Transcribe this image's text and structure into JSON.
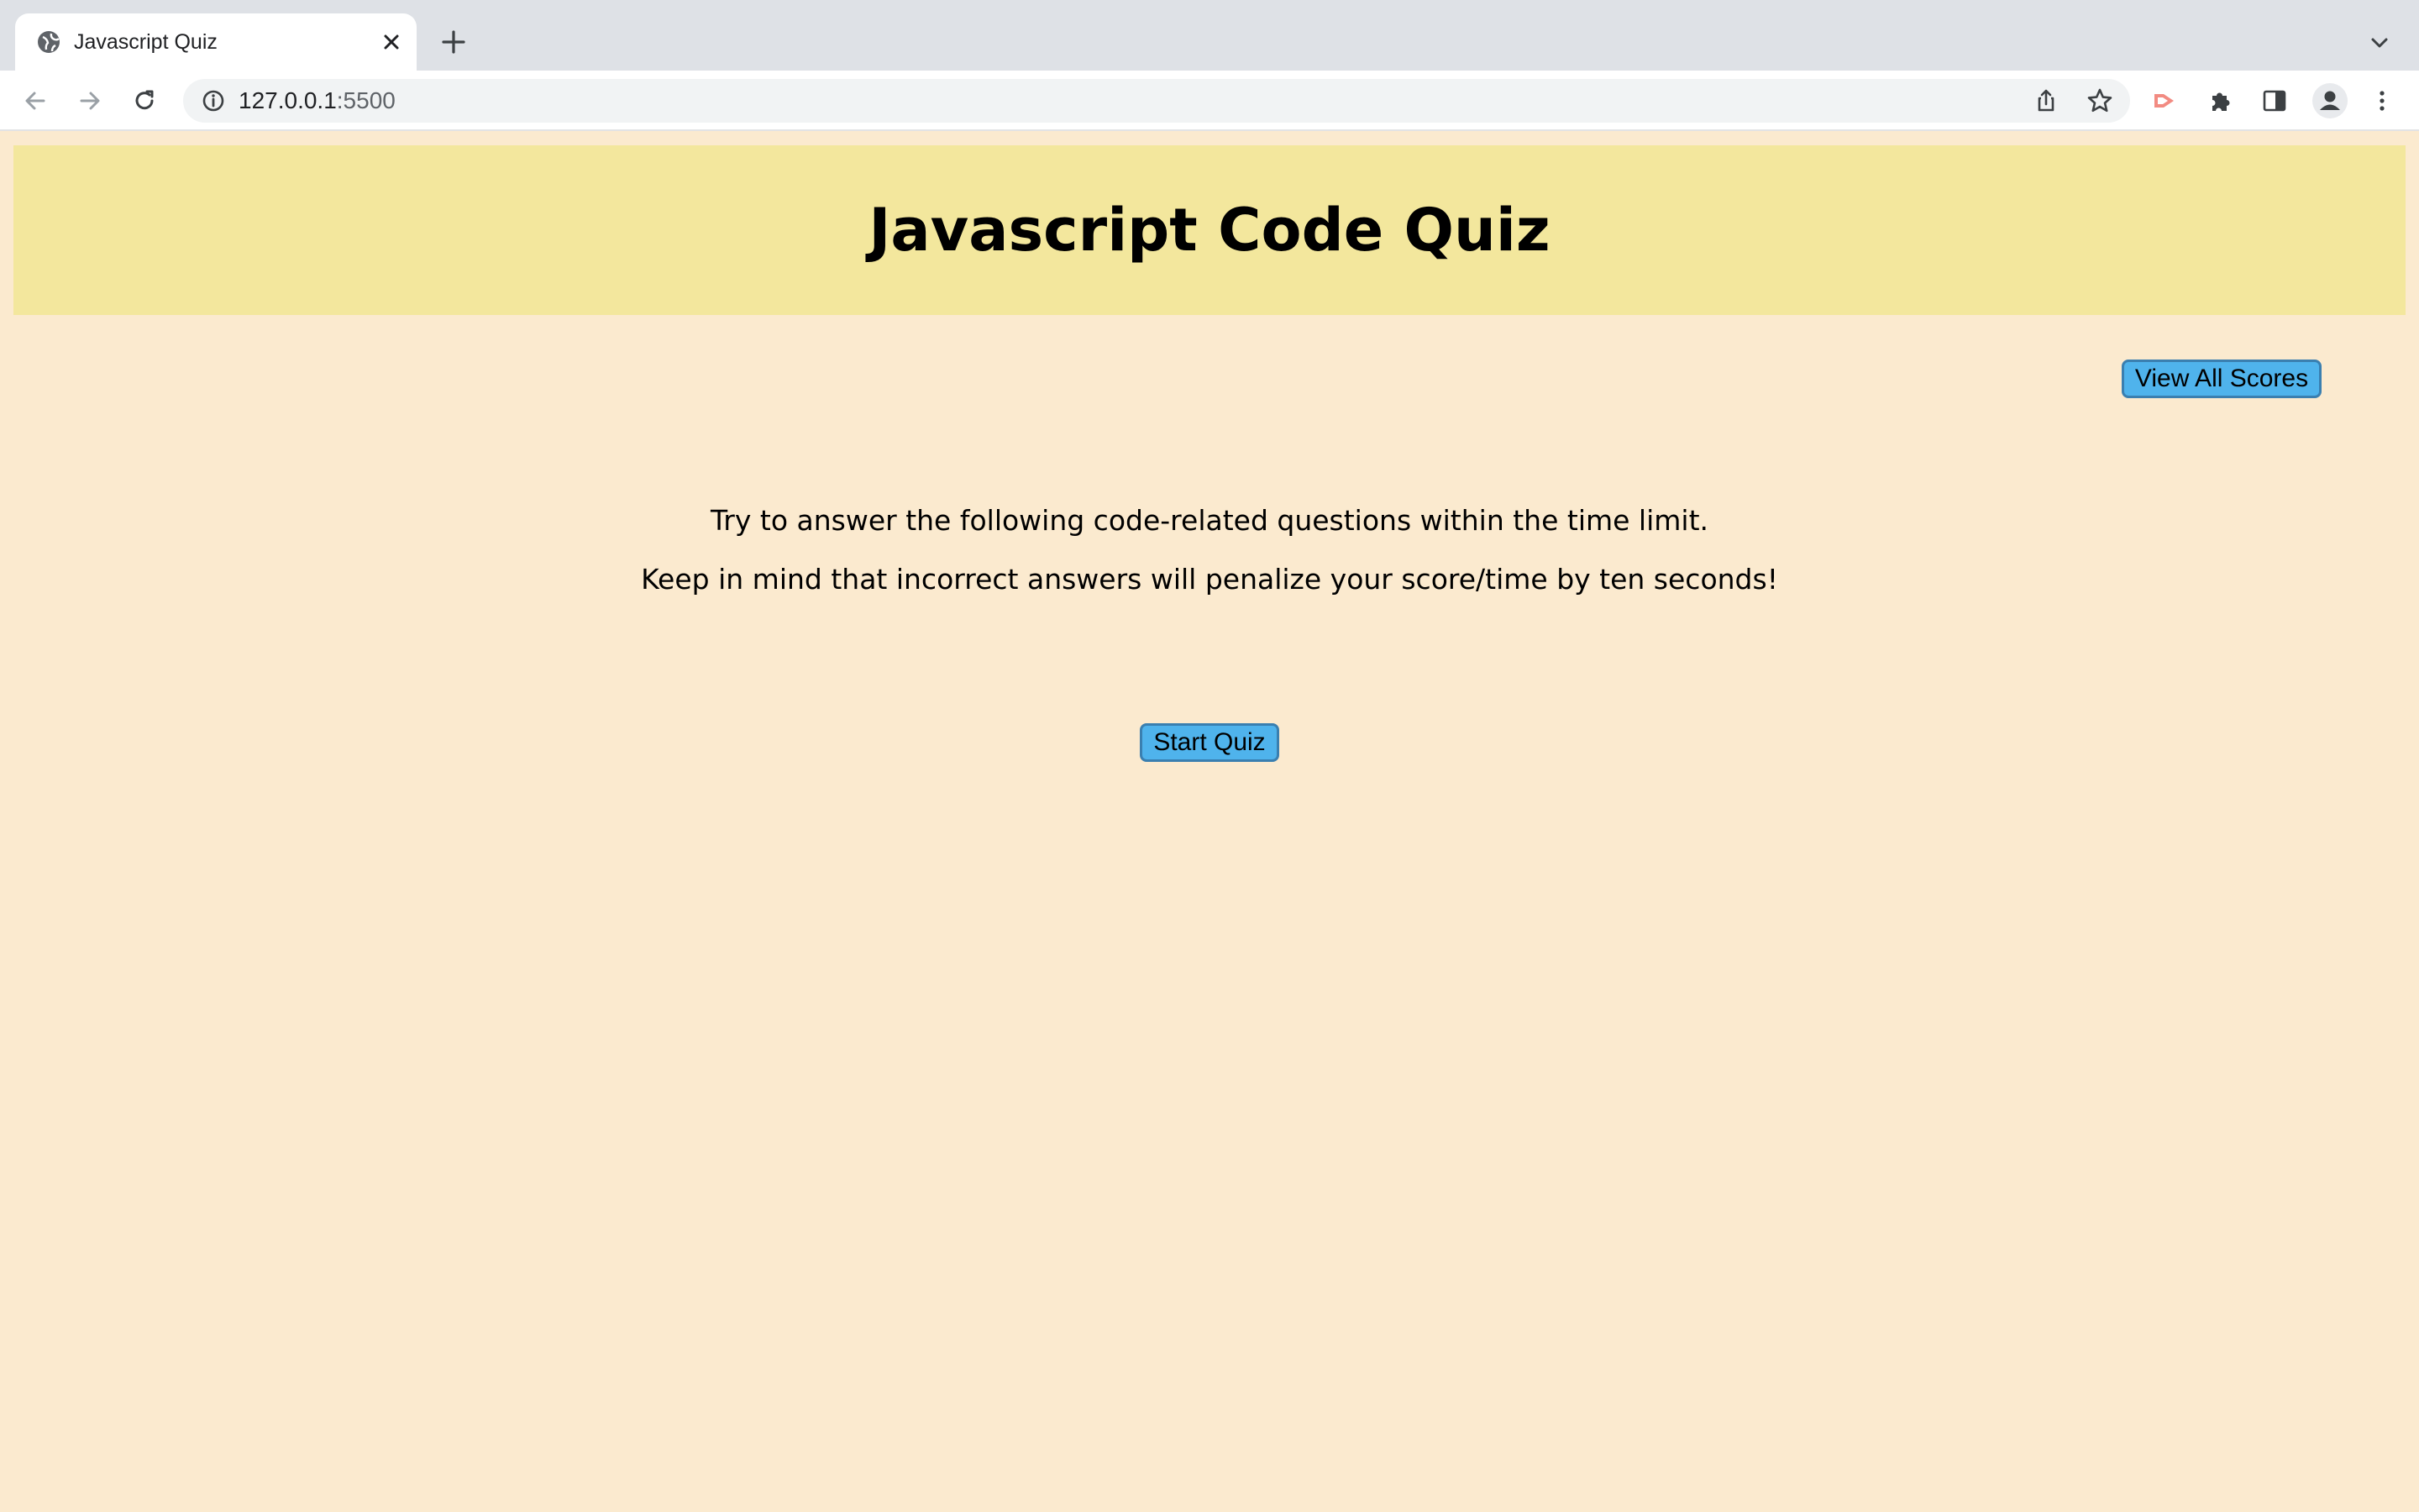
{
  "browser": {
    "tab_title": "Javascript Quiz",
    "url_host": "127.0.0.1",
    "url_port": ":5500"
  },
  "page": {
    "title": "Javascript Code Quiz",
    "view_scores_label": "View All Scores",
    "intro_line_1": "Try to answer the following code-related questions within the time limit.",
    "intro_line_2": "Keep in mind that incorrect answers will penalize your score/time by ten seconds!",
    "start_label": "Start Quiz"
  },
  "colors": {
    "page_background": "#fbeacf",
    "header_band": "#f3e79d",
    "button": "#4fb3ec"
  },
  "icons": {
    "tab_favicon": "globe-icon",
    "tab_close": "close-icon",
    "new_tab": "plus-icon",
    "tab_list": "chevron-down-icon",
    "back": "back-arrow-icon",
    "forward": "forward-arrow-icon",
    "reload": "reload-icon",
    "site_info": "info-icon",
    "share": "share-icon",
    "bookmark": "star-icon",
    "extension_red": "cast-icon",
    "extensions": "puzzle-icon",
    "side_panel": "side-panel-icon",
    "profile": "profile-avatar-icon",
    "menu": "kebab-menu-icon"
  }
}
